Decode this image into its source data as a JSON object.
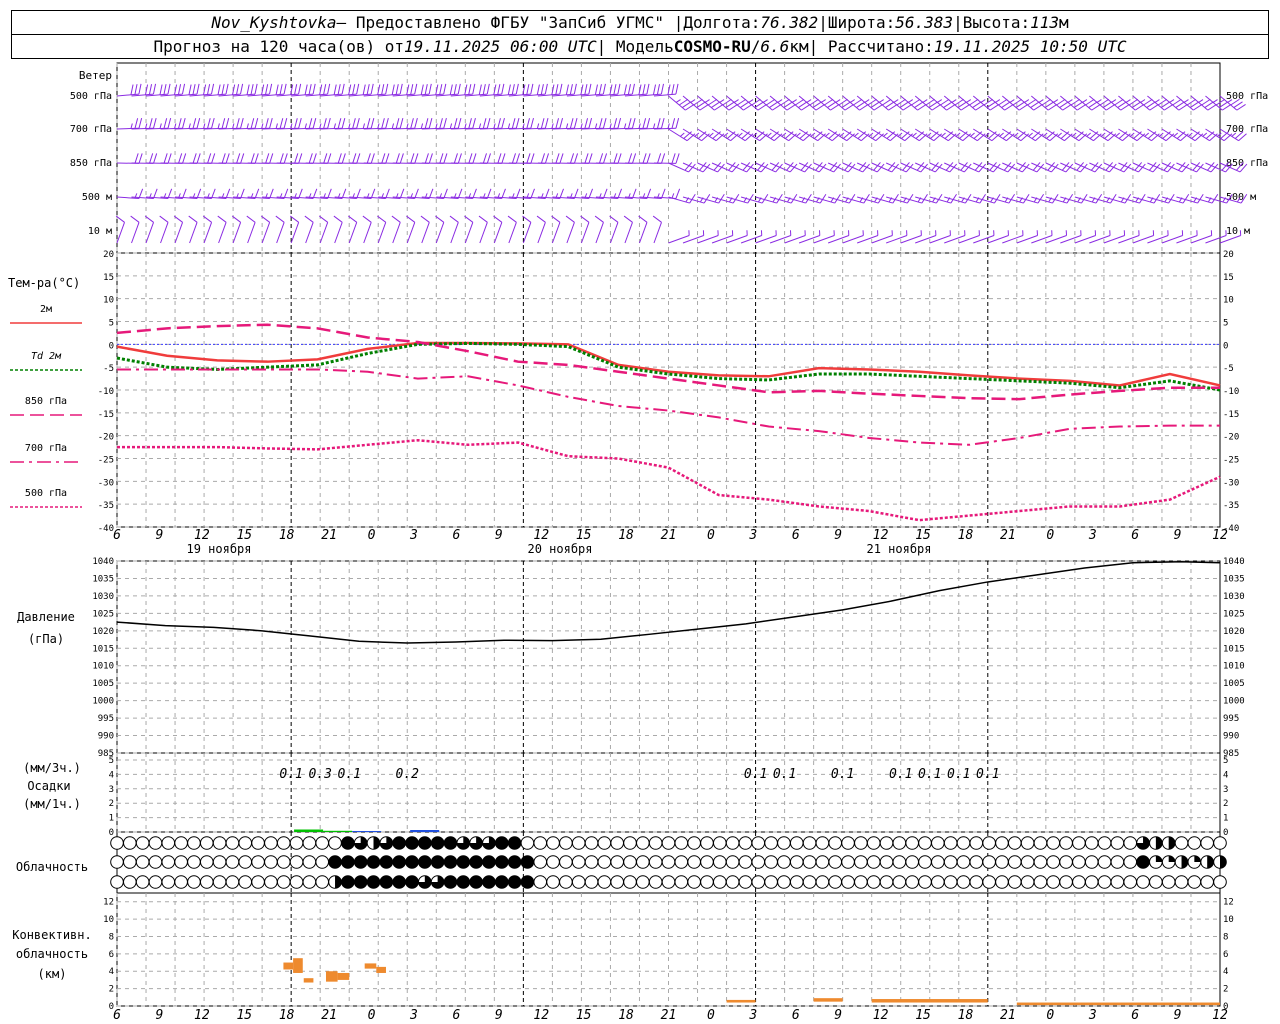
{
  "header": {
    "station": "Nov_Kyshtovka",
    "sep1": " — Предоставлено ФГБУ \"ЗапСиб УГМС\" | ",
    "lon_label": "Долгота: ",
    "lon_value": "76.382",
    "sep2": " | ",
    "lat_label": "Широта: ",
    "lat_value": "56.383",
    "sep3": " | ",
    "alt_label": "Высота: ",
    "alt_value": "113",
    "alt_unit": "м",
    "fc_label": "Прогноз на 120 часа(ов) от ",
    "fc_time": "19.11.2025 06:00 UTC",
    "model_label": " | Модель ",
    "model_name": "COSMO-RU",
    "model_sep": " / ",
    "model_res": "6.6",
    "model_res_unit": "км",
    "calc_label": " | Рассчитано: ",
    "calc_time": "19.11.2025 10:50 UTC"
  },
  "colors": {
    "wind": "#8a2be2",
    "t2m": "#f03c3c",
    "td2m": "#008000",
    "t850": "#e6197a",
    "t700": "#e6197a",
    "t500": "#e6197a",
    "zero": "#3a3aff",
    "pressure": "#000000",
    "precip_liquid": "#00c000",
    "precip_blue": "#2050e0",
    "convective": "#ee8a2e"
  },
  "chart_data": [
    {
      "type": "wind-barbs",
      "title": "Ветер",
      "levels": [
        "500 гПа",
        "700 гПа",
        "850 гПа",
        "500 м",
        "10 м"
      ]
    },
    {
      "type": "line",
      "title": "Тем-ра(°C)",
      "ylim": [
        -40,
        20
      ],
      "yticks": [
        20,
        15,
        10,
        5,
        0,
        -5,
        -10,
        -15,
        -20,
        -25,
        -30,
        -35,
        -40
      ],
      "legend": [
        "2м",
        "Td 2м",
        "850 гПа",
        "700 гПа",
        "500 гПа"
      ],
      "x_hours": [
        0,
        6,
        12,
        18,
        24,
        30,
        36,
        42,
        48,
        54,
        60,
        66,
        72,
        78,
        84,
        90,
        96,
        102,
        108,
        114,
        120
      ],
      "series": [
        {
          "name": "2м",
          "values": [
            -0.5,
            -2.5,
            -3.5,
            -3.8,
            -3.3,
            -1.0,
            0.3,
            0.3,
            0.2,
            0.0,
            -4.5,
            -6.0,
            -6.8,
            -7.0,
            -5.2,
            -5.5,
            -6.0,
            -6.8,
            -7.5,
            -8.0,
            -9.0,
            -6.5,
            -9.0
          ]
        },
        {
          "name": "Td 2м",
          "values": [
            -3.0,
            -5.0,
            -5.5,
            -5.0,
            -4.5,
            -2.0,
            0.0,
            0.2,
            0.0,
            -0.5,
            -5.0,
            -6.5,
            -7.5,
            -7.8,
            -6.5,
            -6.5,
            -7.0,
            -7.5,
            -8.0,
            -8.5,
            -9.5,
            -8.0,
            -10.0
          ]
        },
        {
          "name": "850 гПа",
          "values": [
            2.5,
            3.5,
            4.0,
            4.3,
            3.5,
            1.5,
            0.5,
            -1.5,
            -3.8,
            -4.5,
            -6.0,
            -7.5,
            -9.0,
            -10.5,
            -10.2,
            -10.8,
            -11.3,
            -11.8,
            -12.0,
            -11.0,
            -10.2,
            -9.5,
            -9.5
          ]
        },
        {
          "name": "700 гПа",
          "values": [
            -5.5,
            -5.5,
            -5.5,
            -5.5,
            -5.5,
            -6.0,
            -7.5,
            -7.0,
            -9.0,
            -11.5,
            -13.5,
            -14.5,
            -16.0,
            -18.0,
            -19.0,
            -20.5,
            -21.5,
            -22.0,
            -20.5,
            -18.5,
            -18.0,
            -17.8,
            -17.8
          ]
        },
        {
          "name": "500 гПа",
          "values": [
            -22.5,
            -22.5,
            -22.5,
            -22.8,
            -23.0,
            -22.0,
            -21.0,
            -22.0,
            -21.5,
            -24.5,
            -25.0,
            -27.0,
            -33.0,
            -34.0,
            -35.5,
            -36.5,
            -38.5,
            -37.5,
            -36.5,
            -35.5,
            -35.5,
            -34.0,
            -29.0
          ]
        }
      ],
      "value_step_hours": 5.4545
    },
    {
      "type": "line",
      "title": "Давление",
      "ylabel": "(гПа)",
      "ylim": [
        985,
        1040
      ],
      "yticks": [
        1040,
        1035,
        1030,
        1025,
        1020,
        1015,
        1010,
        1005,
        1000,
        995,
        990,
        985
      ],
      "series": [
        {
          "name": "pressure",
          "values": [
            1022.5,
            1021.5,
            1021.0,
            1020.0,
            1018.5,
            1017.0,
            1016.5,
            1016.8,
            1017.3,
            1017.2,
            1017.6,
            1019.0,
            1020.5,
            1022.0,
            1024.0,
            1026.0,
            1028.5,
            1031.5,
            1034.0,
            1036.0,
            1038.0,
            1039.5,
            1039.8,
            1039.5
          ]
        },
        {
          "name": "x_hours",
          "values": [
            0,
            5,
            10,
            15,
            20,
            25,
            30,
            35,
            40,
            45,
            50,
            55,
            60,
            65,
            70,
            75,
            80,
            85,
            90,
            95,
            100,
            105,
            110,
            114
          ]
        }
      ]
    },
    {
      "type": "bar",
      "title": "Осадки",
      "ylabel_top": "(мм/3ч.)",
      "ylabel_bottom": "(мм/1ч.)",
      "ylim": [
        0,
        5
      ],
      "yticks": [
        5,
        4,
        3,
        2,
        1,
        0
      ],
      "labels": [
        {
          "hour": 18,
          "text": "0.1"
        },
        {
          "hour": 21,
          "text": "0.3"
        },
        {
          "hour": 24,
          "text": "0.1"
        },
        {
          "hour": 30,
          "text": "0.2"
        },
        {
          "hour": 66,
          "text": "0.1"
        },
        {
          "hour": 69,
          "text": "0.1"
        },
        {
          "hour": 75,
          "text": "0.1"
        },
        {
          "hour": 81,
          "text": "0.1"
        },
        {
          "hour": 84,
          "text": "0.1"
        },
        {
          "hour": 87,
          "text": "0.1"
        },
        {
          "hour": 90,
          "text": "0.1"
        }
      ]
    },
    {
      "type": "table",
      "title": "Облачность",
      "rows": [
        "000000000000000000432344444333440000000000000000000000000000000000000000000000003220000",
        "000000000000000004444444444444444000000000000000000000000000000000000000000000004112122",
        "000000000000000002444444334444444000000000000000000000000000000000000000000000000000000"
      ]
    },
    {
      "type": "bar",
      "title": "Конвективн. облачность",
      "ylabel": "(км)",
      "ylim": [
        0,
        13
      ],
      "yticks": [
        12,
        10,
        8,
        6,
        4,
        2,
        0
      ],
      "bars": [
        {
          "h0": 17.2,
          "h1": 18.2,
          "bot": 4.2,
          "top": 5.0
        },
        {
          "h0": 18.2,
          "h1": 19.2,
          "bot": 3.8,
          "top": 5.5
        },
        {
          "h0": 19.3,
          "h1": 20.3,
          "bot": 2.7,
          "top": 3.2
        },
        {
          "h0": 21.6,
          "h1": 22.8,
          "bot": 2.8,
          "top": 4.0
        },
        {
          "h0": 22.8,
          "h1": 24.0,
          "bot": 3.0,
          "top": 3.8
        },
        {
          "h0": 25.6,
          "h1": 26.8,
          "bot": 4.3,
          "top": 4.9
        },
        {
          "h0": 26.8,
          "h1": 27.8,
          "bot": 3.8,
          "top": 4.5
        },
        {
          "h0": 63,
          "h1": 66,
          "bot": 0.4,
          "top": 0.7
        },
        {
          "h0": 72,
          "h1": 75,
          "bot": 0.5,
          "top": 0.9
        },
        {
          "h0": 78,
          "h1": 90,
          "bot": 0.4,
          "top": 0.8
        },
        {
          "h0": 93,
          "h1": 114,
          "bot": 0.1,
          "top": 0.4
        }
      ]
    }
  ],
  "x_axis": {
    "tick_labels": [
      "6",
      "9",
      "12",
      "15",
      "18",
      "21",
      "0",
      "3",
      "6",
      "9",
      "12",
      "15",
      "18",
      "21",
      "0",
      "3",
      "6",
      "9",
      "12",
      "15",
      "18",
      "21",
      "0",
      "3",
      "6",
      "9",
      "12"
    ],
    "dates": [
      "19 ноября",
      "20 ноября",
      "21 ноября"
    ]
  }
}
